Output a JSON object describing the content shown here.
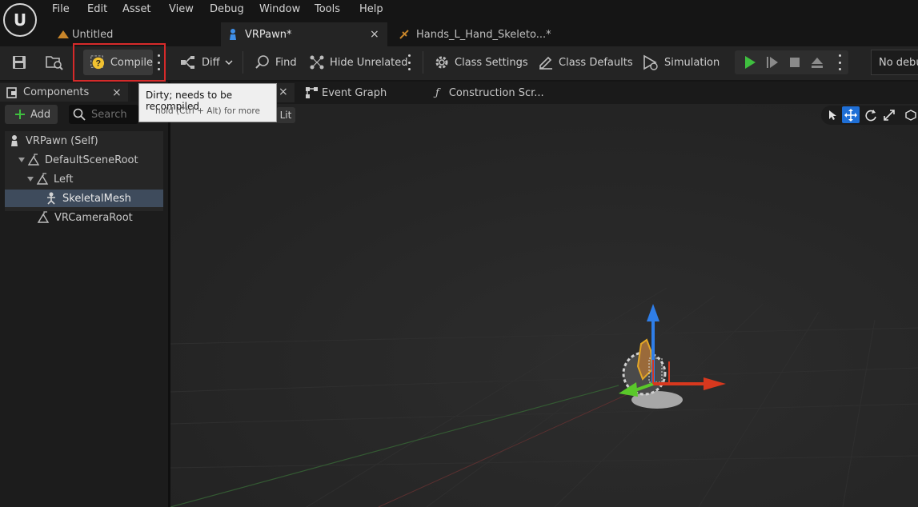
{
  "app": {
    "logo_text": "U"
  },
  "menu": [
    "File",
    "Edit",
    "Asset",
    "View",
    "Debug",
    "Window",
    "Tools",
    "Help"
  ],
  "tabs": [
    {
      "label": "Untitled",
      "active": false
    },
    {
      "label": "VRPawn*",
      "active": true,
      "close": "×"
    },
    {
      "label": "Hands_L_Hand_Skeleto...*",
      "active": false
    }
  ],
  "toolbar": {
    "compile": "Compile",
    "diff": "Diff",
    "find": "Find",
    "hide_unrelated": "Hide Unrelated",
    "class_settings": "Class Settings",
    "class_defaults": "Class Defaults",
    "simulation": "Simulation",
    "debug_dropdown": "No debug"
  },
  "tooltip": {
    "title": "Dirty; needs to be recompiled",
    "subtitle": "hold (Ctrl + Alt) for more"
  },
  "components": {
    "tab_label": "Components",
    "close": "×",
    "add_label": "Add",
    "search_placeholder": "Search",
    "tree": [
      {
        "label": "VRPawn (Self)"
      },
      {
        "label": "DefaultSceneRoot"
      },
      {
        "label": "Left"
      },
      {
        "label": "SkeletalMesh",
        "selected": true
      },
      {
        "label": "VRCameraRoot"
      }
    ]
  },
  "editor_tabs": {
    "viewport_close": "×",
    "event_graph": "Event Graph",
    "construction": "Construction Scr..."
  },
  "viewport": {
    "lit_label": "Lit"
  },
  "colors": {
    "accent": "#1f6fd6",
    "play": "#3fbf3f",
    "highlight": "#d62a2a",
    "selected_row": "#3e4b5c"
  }
}
